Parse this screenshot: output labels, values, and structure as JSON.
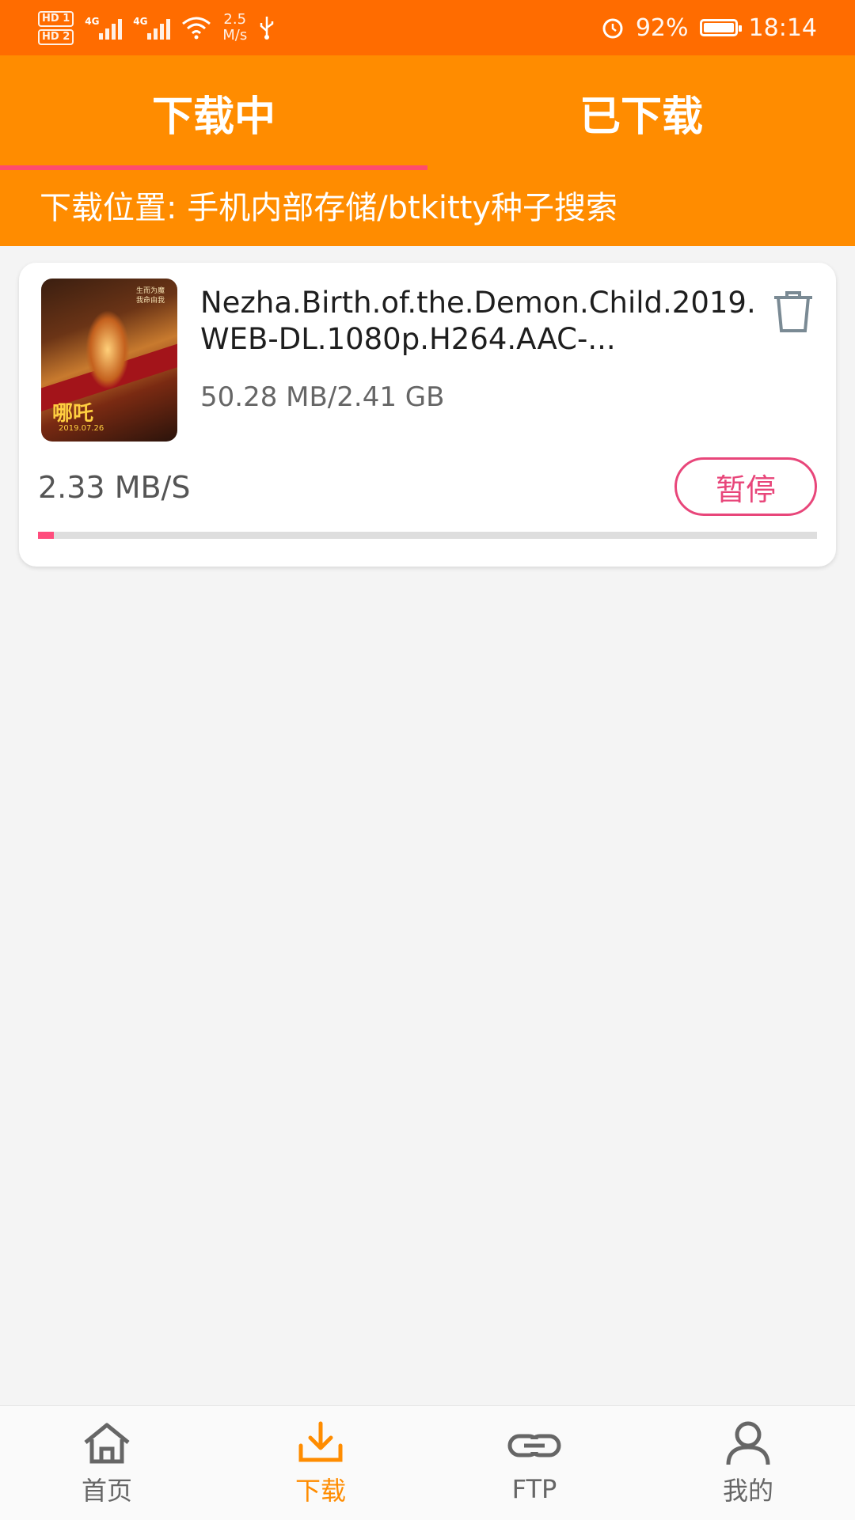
{
  "status_bar": {
    "hd1": "HD 1",
    "hd2": "HD 2",
    "sim1": "4G",
    "sim2": "4G",
    "net_speed_value": "2.5",
    "net_speed_unit": "M/s",
    "battery": "92%",
    "time": "18:14"
  },
  "tabs": [
    {
      "label": "下载中",
      "active": true
    },
    {
      "label": "已下载",
      "active": false
    }
  ],
  "download_location": "下载位置: 手机内部存储/btkitty种子搜索",
  "downloads": [
    {
      "name": "Nezha.Birth.of.the.Demon.Child.2019.WEB-DL.1080p.H264.AAC-...",
      "size": "50.28 MB/2.41 GB",
      "speed": "2.33 MB/S",
      "action_label": "暂停",
      "progress": 0.02,
      "poster_date": "2019.07.26"
    }
  ],
  "bottom_nav": [
    {
      "label": "首页",
      "icon": "home-icon"
    },
    {
      "label": "下载",
      "icon": "download-icon",
      "active": true
    },
    {
      "label": "FTP",
      "icon": "link-icon"
    },
    {
      "label": "我的",
      "icon": "user-icon"
    }
  ],
  "colors": {
    "status_bar": "#ff6c00",
    "header": "#ff8c00",
    "accent_pink": "#ff4d6d",
    "pause_pink": "#e8467a",
    "active_nav": "#ff8c00"
  }
}
